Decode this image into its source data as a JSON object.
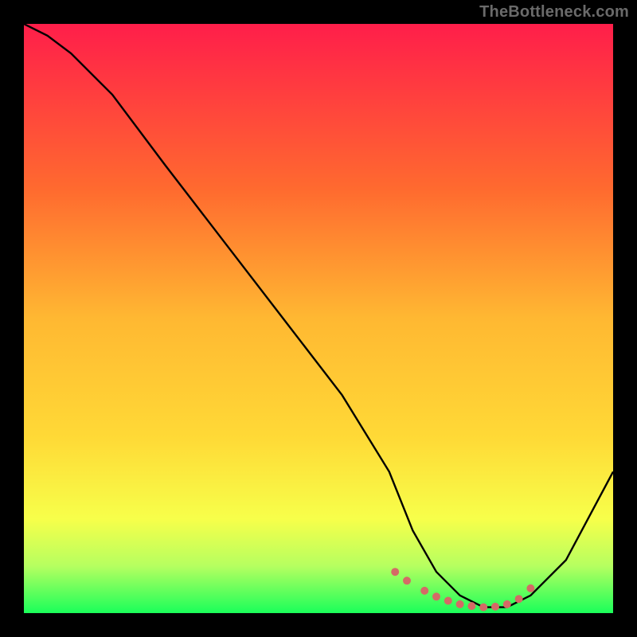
{
  "watermark": "TheBottleneck.com",
  "colors": {
    "bg": "#000000",
    "grad_top": "#ff1e4a",
    "grad_upper_mid": "#ff8b2a",
    "grad_mid": "#ffd936",
    "grad_lower_mid": "#f7ff4a",
    "grad_low": "#c8ff6a",
    "grad_bottom": "#1aff5a",
    "curve": "#000000",
    "dots": "#d46a66"
  },
  "chart_data": {
    "type": "line",
    "title": "",
    "xlabel": "",
    "ylabel": "",
    "xlim": [
      0,
      100
    ],
    "ylim": [
      0,
      100
    ],
    "grid": false,
    "legend": false,
    "series": [
      {
        "name": "bottleneck-curve",
        "x": [
          0,
          4,
          8,
          15,
          24,
          34,
          44,
          54,
          62,
          66,
          70,
          74,
          78,
          82,
          86,
          92,
          100
        ],
        "y": [
          100,
          98,
          95,
          88,
          76,
          63,
          50,
          37,
          24,
          14,
          7,
          3,
          1,
          1,
          3,
          9,
          24
        ]
      }
    ],
    "highlight_points": {
      "name": "sweet-spot-dots",
      "x": [
        63,
        65,
        68,
        70,
        72,
        74,
        76,
        78,
        80,
        82,
        84,
        86
      ],
      "y": [
        7,
        5.5,
        3.8,
        2.8,
        2.1,
        1.5,
        1.2,
        1.0,
        1.1,
        1.5,
        2.4,
        4.2
      ]
    }
  }
}
